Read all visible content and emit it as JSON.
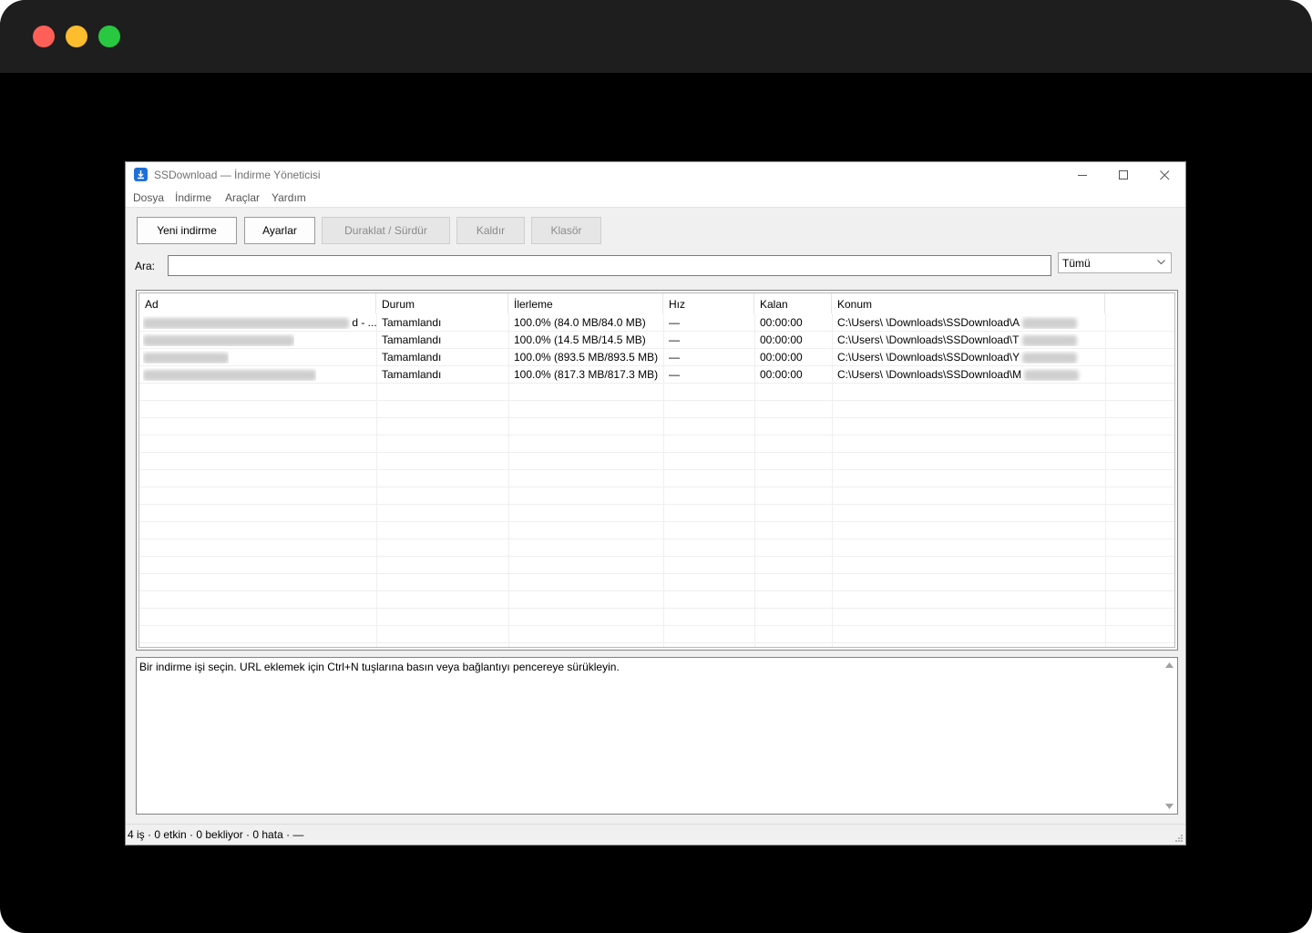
{
  "window": {
    "title": "SSDownload — İndirme Yöneticisi"
  },
  "menu": [
    "Dosya",
    "İndirme",
    "Araçlar",
    "Yardım"
  ],
  "toolbar": {
    "new_download": "Yeni indirme",
    "settings": "Ayarlar",
    "pause_resume": "Duraklat / Sürdür",
    "remove": "Kaldır",
    "folder": "Klasör"
  },
  "search": {
    "label": "Ara:",
    "value": "",
    "filter_selected": "Tümü"
  },
  "columns": [
    "Ad",
    "Durum",
    "İlerleme",
    "Hız",
    "Kalan",
    "Konum"
  ],
  "rows": [
    {
      "name_suffix": "d - ...",
      "status": "Tamamlandı",
      "progress": "100.0% (84.0 MB/84.0 MB)",
      "speed": "—",
      "remaining": "00:00:00",
      "location": "C:\\Users\\      \\Downloads\\SSDownload\\A"
    },
    {
      "name_suffix": "",
      "status": "Tamamlandı",
      "progress": "100.0% (14.5 MB/14.5 MB)",
      "speed": "—",
      "remaining": "00:00:00",
      "location": "C:\\Users\\      \\Downloads\\SSDownload\\T"
    },
    {
      "name_suffix": "",
      "status": "Tamamlandı",
      "progress": "100.0% (893.5 MB/893.5 MB)",
      "speed": "—",
      "remaining": "00:00:00",
      "location": "C:\\Users\\      \\Downloads\\SSDownload\\Y"
    },
    {
      "name_suffix": "",
      "status": "Tamamlandı",
      "progress": "100.0% (817.3 MB/817.3 MB)",
      "speed": "—",
      "remaining": "00:00:00",
      "location": "C:\\Users\\      \\Downloads\\SSDownload\\M"
    }
  ],
  "details": {
    "text": "Bir indirme işi seçin. URL eklemek için Ctrl+N tuşlarına basın veya bağlantıyı pencereye sürükleyin."
  },
  "status": {
    "text": "4 iş · 0 etkin · 0 bekliyor · 0 hata · —"
  }
}
